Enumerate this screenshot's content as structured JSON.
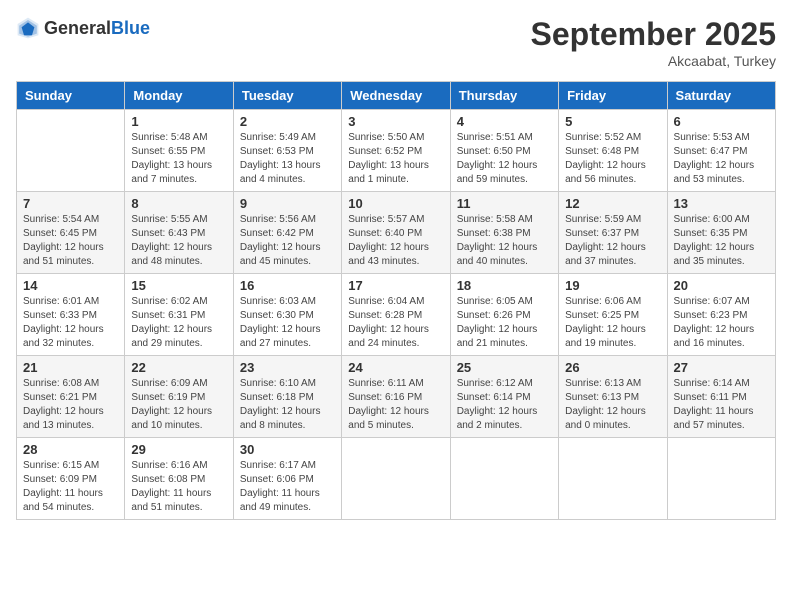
{
  "header": {
    "logo_general": "General",
    "logo_blue": "Blue",
    "month_title": "September 2025",
    "subtitle": "Akcaabat, Turkey"
  },
  "days_of_week": [
    "Sunday",
    "Monday",
    "Tuesday",
    "Wednesday",
    "Thursday",
    "Friday",
    "Saturday"
  ],
  "weeks": [
    [
      {
        "day": "",
        "info": ""
      },
      {
        "day": "1",
        "info": "Sunrise: 5:48 AM\nSunset: 6:55 PM\nDaylight: 13 hours\nand 7 minutes."
      },
      {
        "day": "2",
        "info": "Sunrise: 5:49 AM\nSunset: 6:53 PM\nDaylight: 13 hours\nand 4 minutes."
      },
      {
        "day": "3",
        "info": "Sunrise: 5:50 AM\nSunset: 6:52 PM\nDaylight: 13 hours\nand 1 minute."
      },
      {
        "day": "4",
        "info": "Sunrise: 5:51 AM\nSunset: 6:50 PM\nDaylight: 12 hours\nand 59 minutes."
      },
      {
        "day": "5",
        "info": "Sunrise: 5:52 AM\nSunset: 6:48 PM\nDaylight: 12 hours\nand 56 minutes."
      },
      {
        "day": "6",
        "info": "Sunrise: 5:53 AM\nSunset: 6:47 PM\nDaylight: 12 hours\nand 53 minutes."
      }
    ],
    [
      {
        "day": "7",
        "info": "Sunrise: 5:54 AM\nSunset: 6:45 PM\nDaylight: 12 hours\nand 51 minutes."
      },
      {
        "day": "8",
        "info": "Sunrise: 5:55 AM\nSunset: 6:43 PM\nDaylight: 12 hours\nand 48 minutes."
      },
      {
        "day": "9",
        "info": "Sunrise: 5:56 AM\nSunset: 6:42 PM\nDaylight: 12 hours\nand 45 minutes."
      },
      {
        "day": "10",
        "info": "Sunrise: 5:57 AM\nSunset: 6:40 PM\nDaylight: 12 hours\nand 43 minutes."
      },
      {
        "day": "11",
        "info": "Sunrise: 5:58 AM\nSunset: 6:38 PM\nDaylight: 12 hours\nand 40 minutes."
      },
      {
        "day": "12",
        "info": "Sunrise: 5:59 AM\nSunset: 6:37 PM\nDaylight: 12 hours\nand 37 minutes."
      },
      {
        "day": "13",
        "info": "Sunrise: 6:00 AM\nSunset: 6:35 PM\nDaylight: 12 hours\nand 35 minutes."
      }
    ],
    [
      {
        "day": "14",
        "info": "Sunrise: 6:01 AM\nSunset: 6:33 PM\nDaylight: 12 hours\nand 32 minutes."
      },
      {
        "day": "15",
        "info": "Sunrise: 6:02 AM\nSunset: 6:31 PM\nDaylight: 12 hours\nand 29 minutes."
      },
      {
        "day": "16",
        "info": "Sunrise: 6:03 AM\nSunset: 6:30 PM\nDaylight: 12 hours\nand 27 minutes."
      },
      {
        "day": "17",
        "info": "Sunrise: 6:04 AM\nSunset: 6:28 PM\nDaylight: 12 hours\nand 24 minutes."
      },
      {
        "day": "18",
        "info": "Sunrise: 6:05 AM\nSunset: 6:26 PM\nDaylight: 12 hours\nand 21 minutes."
      },
      {
        "day": "19",
        "info": "Sunrise: 6:06 AM\nSunset: 6:25 PM\nDaylight: 12 hours\nand 19 minutes."
      },
      {
        "day": "20",
        "info": "Sunrise: 6:07 AM\nSunset: 6:23 PM\nDaylight: 12 hours\nand 16 minutes."
      }
    ],
    [
      {
        "day": "21",
        "info": "Sunrise: 6:08 AM\nSunset: 6:21 PM\nDaylight: 12 hours\nand 13 minutes."
      },
      {
        "day": "22",
        "info": "Sunrise: 6:09 AM\nSunset: 6:19 PM\nDaylight: 12 hours\nand 10 minutes."
      },
      {
        "day": "23",
        "info": "Sunrise: 6:10 AM\nSunset: 6:18 PM\nDaylight: 12 hours\nand 8 minutes."
      },
      {
        "day": "24",
        "info": "Sunrise: 6:11 AM\nSunset: 6:16 PM\nDaylight: 12 hours\nand 5 minutes."
      },
      {
        "day": "25",
        "info": "Sunrise: 6:12 AM\nSunset: 6:14 PM\nDaylight: 12 hours\nand 2 minutes."
      },
      {
        "day": "26",
        "info": "Sunrise: 6:13 AM\nSunset: 6:13 PM\nDaylight: 12 hours\nand 0 minutes."
      },
      {
        "day": "27",
        "info": "Sunrise: 6:14 AM\nSunset: 6:11 PM\nDaylight: 11 hours\nand 57 minutes."
      }
    ],
    [
      {
        "day": "28",
        "info": "Sunrise: 6:15 AM\nSunset: 6:09 PM\nDaylight: 11 hours\nand 54 minutes."
      },
      {
        "day": "29",
        "info": "Sunrise: 6:16 AM\nSunset: 6:08 PM\nDaylight: 11 hours\nand 51 minutes."
      },
      {
        "day": "30",
        "info": "Sunrise: 6:17 AM\nSunset: 6:06 PM\nDaylight: 11 hours\nand 49 minutes."
      },
      {
        "day": "",
        "info": ""
      },
      {
        "day": "",
        "info": ""
      },
      {
        "day": "",
        "info": ""
      },
      {
        "day": "",
        "info": ""
      }
    ]
  ]
}
